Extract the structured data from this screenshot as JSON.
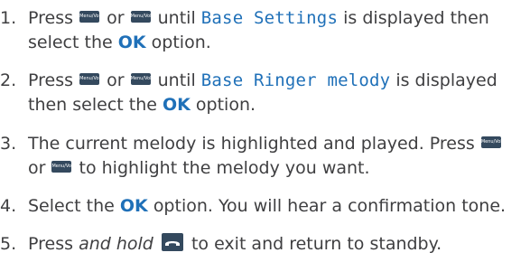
{
  "steps": [
    {
      "number": "1.",
      "press": "Press",
      "key_up": "Menu/Vol+",
      "or": "or",
      "key_down": "Menu/Vol-",
      "until": "until",
      "display_text": "Base Settings",
      "after_display": "is displayed then",
      "line2_prefix": "select the",
      "ok": "OK",
      "line2_suffix": "option."
    },
    {
      "number": "2.",
      "press": "Press",
      "key_up": "Menu/Vol+",
      "or": "or",
      "key_down": "Menu/Vol-",
      "until": "until",
      "display_text": "Base Ringer melody",
      "after_display": "is displayed",
      "line2_prefix": "then select the",
      "ok": "OK",
      "line2_suffix": "option."
    },
    {
      "number": "3.",
      "line1": "The current melody is highlighted and played. Press",
      "key_up": "Menu/Vol+",
      "line2_prefix": "or",
      "key_down": "Menu/Vol-",
      "line2_suffix": "to highlight the melody you want."
    },
    {
      "number": "4.",
      "prefix": "Select the",
      "ok": "OK",
      "suffix": "option. You will hear a confirmation tone."
    },
    {
      "number": "5.",
      "press": "Press",
      "hold": "and hold",
      "end_icon": "end-call-icon",
      "suffix": "to exit and return to standby."
    }
  ],
  "colors": {
    "text": "#3f3f41",
    "accent": "#1f70b8",
    "key_bg": "#34495e"
  }
}
